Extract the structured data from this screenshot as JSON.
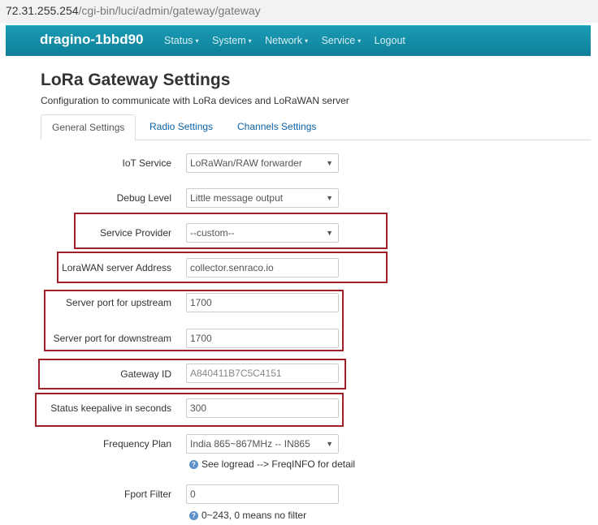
{
  "browser": {
    "url_host": "72.31.255.254",
    "url_path": "/cgi-bin/luci/admin/gateway/gateway"
  },
  "navbar": {
    "brand": "dragino-1bbd90",
    "menu": [
      {
        "label": "Status",
        "has_caret": true
      },
      {
        "label": "System",
        "has_caret": true
      },
      {
        "label": "Network",
        "has_caret": true
      },
      {
        "label": "Service",
        "has_caret": true
      },
      {
        "label": "Logout",
        "has_caret": false
      }
    ],
    "caret": "▾"
  },
  "page": {
    "title": "LoRa Gateway Settings",
    "description": "Configuration to communicate with LoRa devices and LoRaWAN server"
  },
  "tabs": [
    "General Settings",
    "Radio Settings",
    "Channels Settings"
  ],
  "form": {
    "iot_service": {
      "label": "IoT Service",
      "value": "LoRaWan/RAW forwarder"
    },
    "debug_level": {
      "label": "Debug Level",
      "value": "Little message output"
    },
    "service_provider": {
      "label": "Service Provider",
      "value": "--custom--"
    },
    "server_address": {
      "label": "LoraWAN server Address",
      "value": "collector.senraco.io"
    },
    "port_up": {
      "label": "Server port for upstream",
      "value": "1700"
    },
    "port_down": {
      "label": "Server port for downstream",
      "value": "1700"
    },
    "gateway_id": {
      "label": "Gateway ID",
      "value": "A840411B7C5C4151"
    },
    "keepalive": {
      "label": "Status keepalive in seconds",
      "value": "300"
    },
    "frequency_plan": {
      "label": "Frequency Plan",
      "value": "India 865~867MHz -- IN865",
      "hint": "See logread --> FreqINFO for detail"
    },
    "fport_filter": {
      "label": "Fport Filter",
      "value": "0",
      "hint": "0~243, 0 means no filter"
    }
  },
  "highlight_color": "#a0202a",
  "accent_color": "#1a9bb5"
}
